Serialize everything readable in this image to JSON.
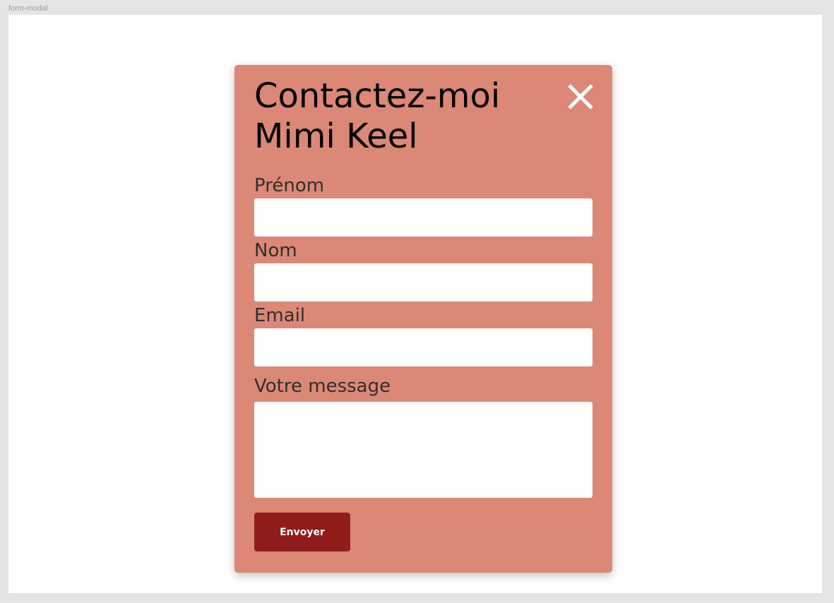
{
  "frame": {
    "label": "form-modal"
  },
  "modal": {
    "title_line1": "Contactez-moi",
    "title_line2": "Mimi Keel",
    "close_icon": "close-icon",
    "background_color": "#db8876"
  },
  "form": {
    "first_name": {
      "label": "Prénom",
      "value": ""
    },
    "last_name": {
      "label": "Nom",
      "value": ""
    },
    "email": {
      "label": "Email",
      "value": ""
    },
    "message": {
      "label": "Votre message",
      "value": ""
    },
    "submit_label": "Envoyer",
    "submit_color": "#901c1c"
  }
}
